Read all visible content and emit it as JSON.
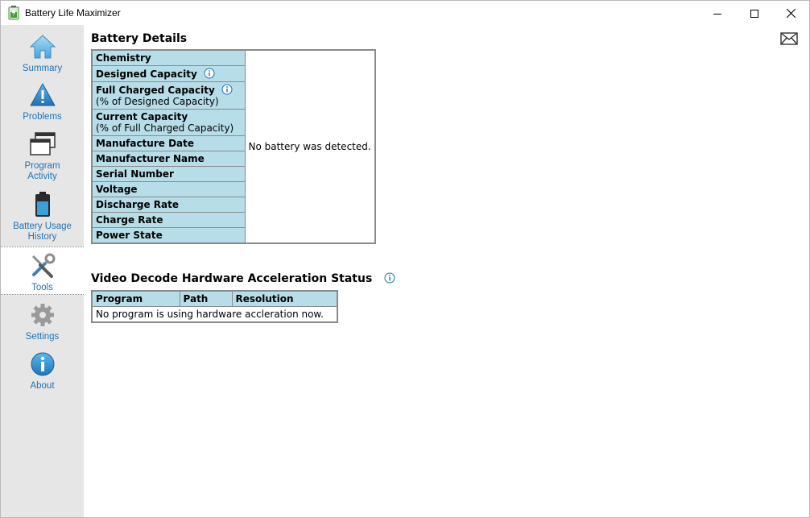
{
  "window": {
    "title": "Battery Life Maximizer"
  },
  "sidebar": {
    "items": [
      {
        "label": "Summary",
        "icon": "home-icon"
      },
      {
        "label": "Problems",
        "icon": "warning-icon"
      },
      {
        "label": "Program Activity",
        "icon": "windows-icon"
      },
      {
        "label": "Battery Usage History",
        "icon": "battery-icon"
      },
      {
        "label": "Tools",
        "icon": "tools-icon",
        "active": true
      },
      {
        "label": "Settings",
        "icon": "gear-icon"
      },
      {
        "label": "About",
        "icon": "info-icon"
      }
    ]
  },
  "battery_details": {
    "title": "Battery Details",
    "rows": [
      {
        "label": "Chemistry"
      },
      {
        "label": "Designed Capacity",
        "info": true
      },
      {
        "label": "Full Charged Capacity",
        "sub": "(% of Designed Capacity)",
        "info": true
      },
      {
        "label": "Current Capacity",
        "sub": "(% of Full Charged Capacity)"
      },
      {
        "label": "Manufacture Date"
      },
      {
        "label": "Manufacturer Name"
      },
      {
        "label": "Serial Number"
      },
      {
        "label": "Voltage"
      },
      {
        "label": "Discharge Rate"
      },
      {
        "label": "Charge Rate"
      },
      {
        "label": "Power State"
      }
    ],
    "value_message": "No battery was detected."
  },
  "video_decode": {
    "title": "Video Decode Hardware Acceleration Status",
    "columns": [
      "Program",
      "Path",
      "Resolution"
    ],
    "empty_message": "No program is using hardware accleration now."
  },
  "colors": {
    "accent": "#1e73b7",
    "table_header": "#b7dde8",
    "sidebar_bg": "#e6e6e6"
  }
}
